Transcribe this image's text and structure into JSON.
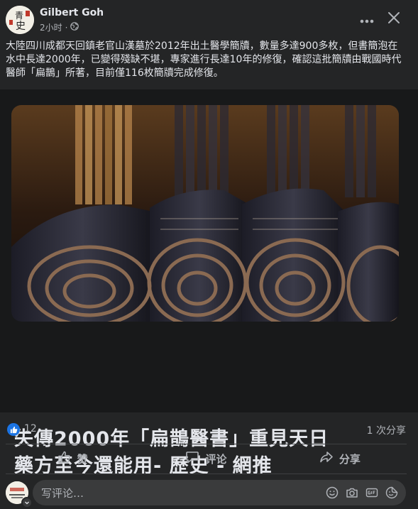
{
  "post": {
    "author": "Gilbert Goh",
    "time": "2小时",
    "separator": "·",
    "privacy_icon": "globe-icon",
    "text": "大陸四川成都天回鎮老官山漢墓於2012年出土醫學簡牘，數量多達900多枚，但書簡泡在水中長達2000年，已變得殘缺不堪，專家進行長達10年的修復，確認這批簡牘由戰國時代醫師「扁鵲」所著，目前僅116枚簡牘完成修復。"
  },
  "link_card": {
    "title_line1": "失傳2000年「扁鵲醫書」重見天日",
    "title_line2": "藥方至今還能用- 歷史 - 網推"
  },
  "stats": {
    "like_count": "12",
    "share_count": "1 次分享"
  },
  "actions": {
    "like_label": "赞",
    "comment_label": "评论",
    "share_label": "分享"
  },
  "comment": {
    "placeholder": "写评论…"
  },
  "colors": {
    "background": "#242526",
    "card_background": "#18191a",
    "like_blue": "#1b74e4",
    "text_primary": "#e4e6eb",
    "text_secondary": "#b0b3b8"
  }
}
